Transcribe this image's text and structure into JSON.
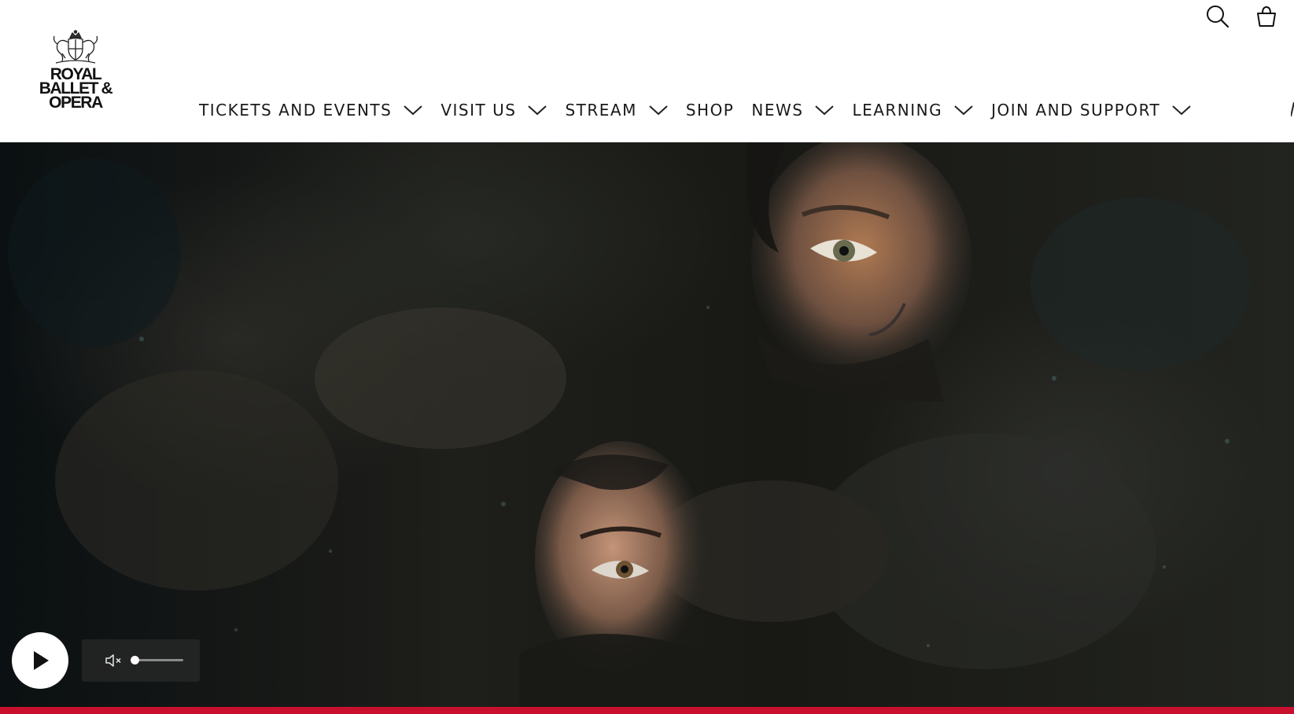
{
  "header": {
    "logo": {
      "lines": [
        "ROYAL",
        "BALLET &",
        "OPERA"
      ],
      "crest_icon": "royal-crest-icon"
    },
    "utility": {
      "search_icon": "search-icon",
      "basket_icon": "basket-icon"
    },
    "nav": {
      "items": [
        {
          "label": "TICKETS AND EVENTS",
          "has_dropdown": true
        },
        {
          "label": "VISIT US",
          "has_dropdown": true
        },
        {
          "label": "STREAM",
          "has_dropdown": true
        },
        {
          "label": "SHOP",
          "has_dropdown": false
        },
        {
          "label": "NEWS",
          "has_dropdown": true
        },
        {
          "label": "LEARNING",
          "has_dropdown": true
        },
        {
          "label": "JOIN AND SUPPORT",
          "has_dropdown": true
        }
      ]
    }
  },
  "hero": {
    "media": {
      "play_icon": "play-icon",
      "mute_icon": "volume-muted-icon",
      "volume_level": 0.0
    }
  },
  "colors": {
    "accent": "#c8102e",
    "header_bg": "#ffffff",
    "text": "#1a1a1a"
  }
}
